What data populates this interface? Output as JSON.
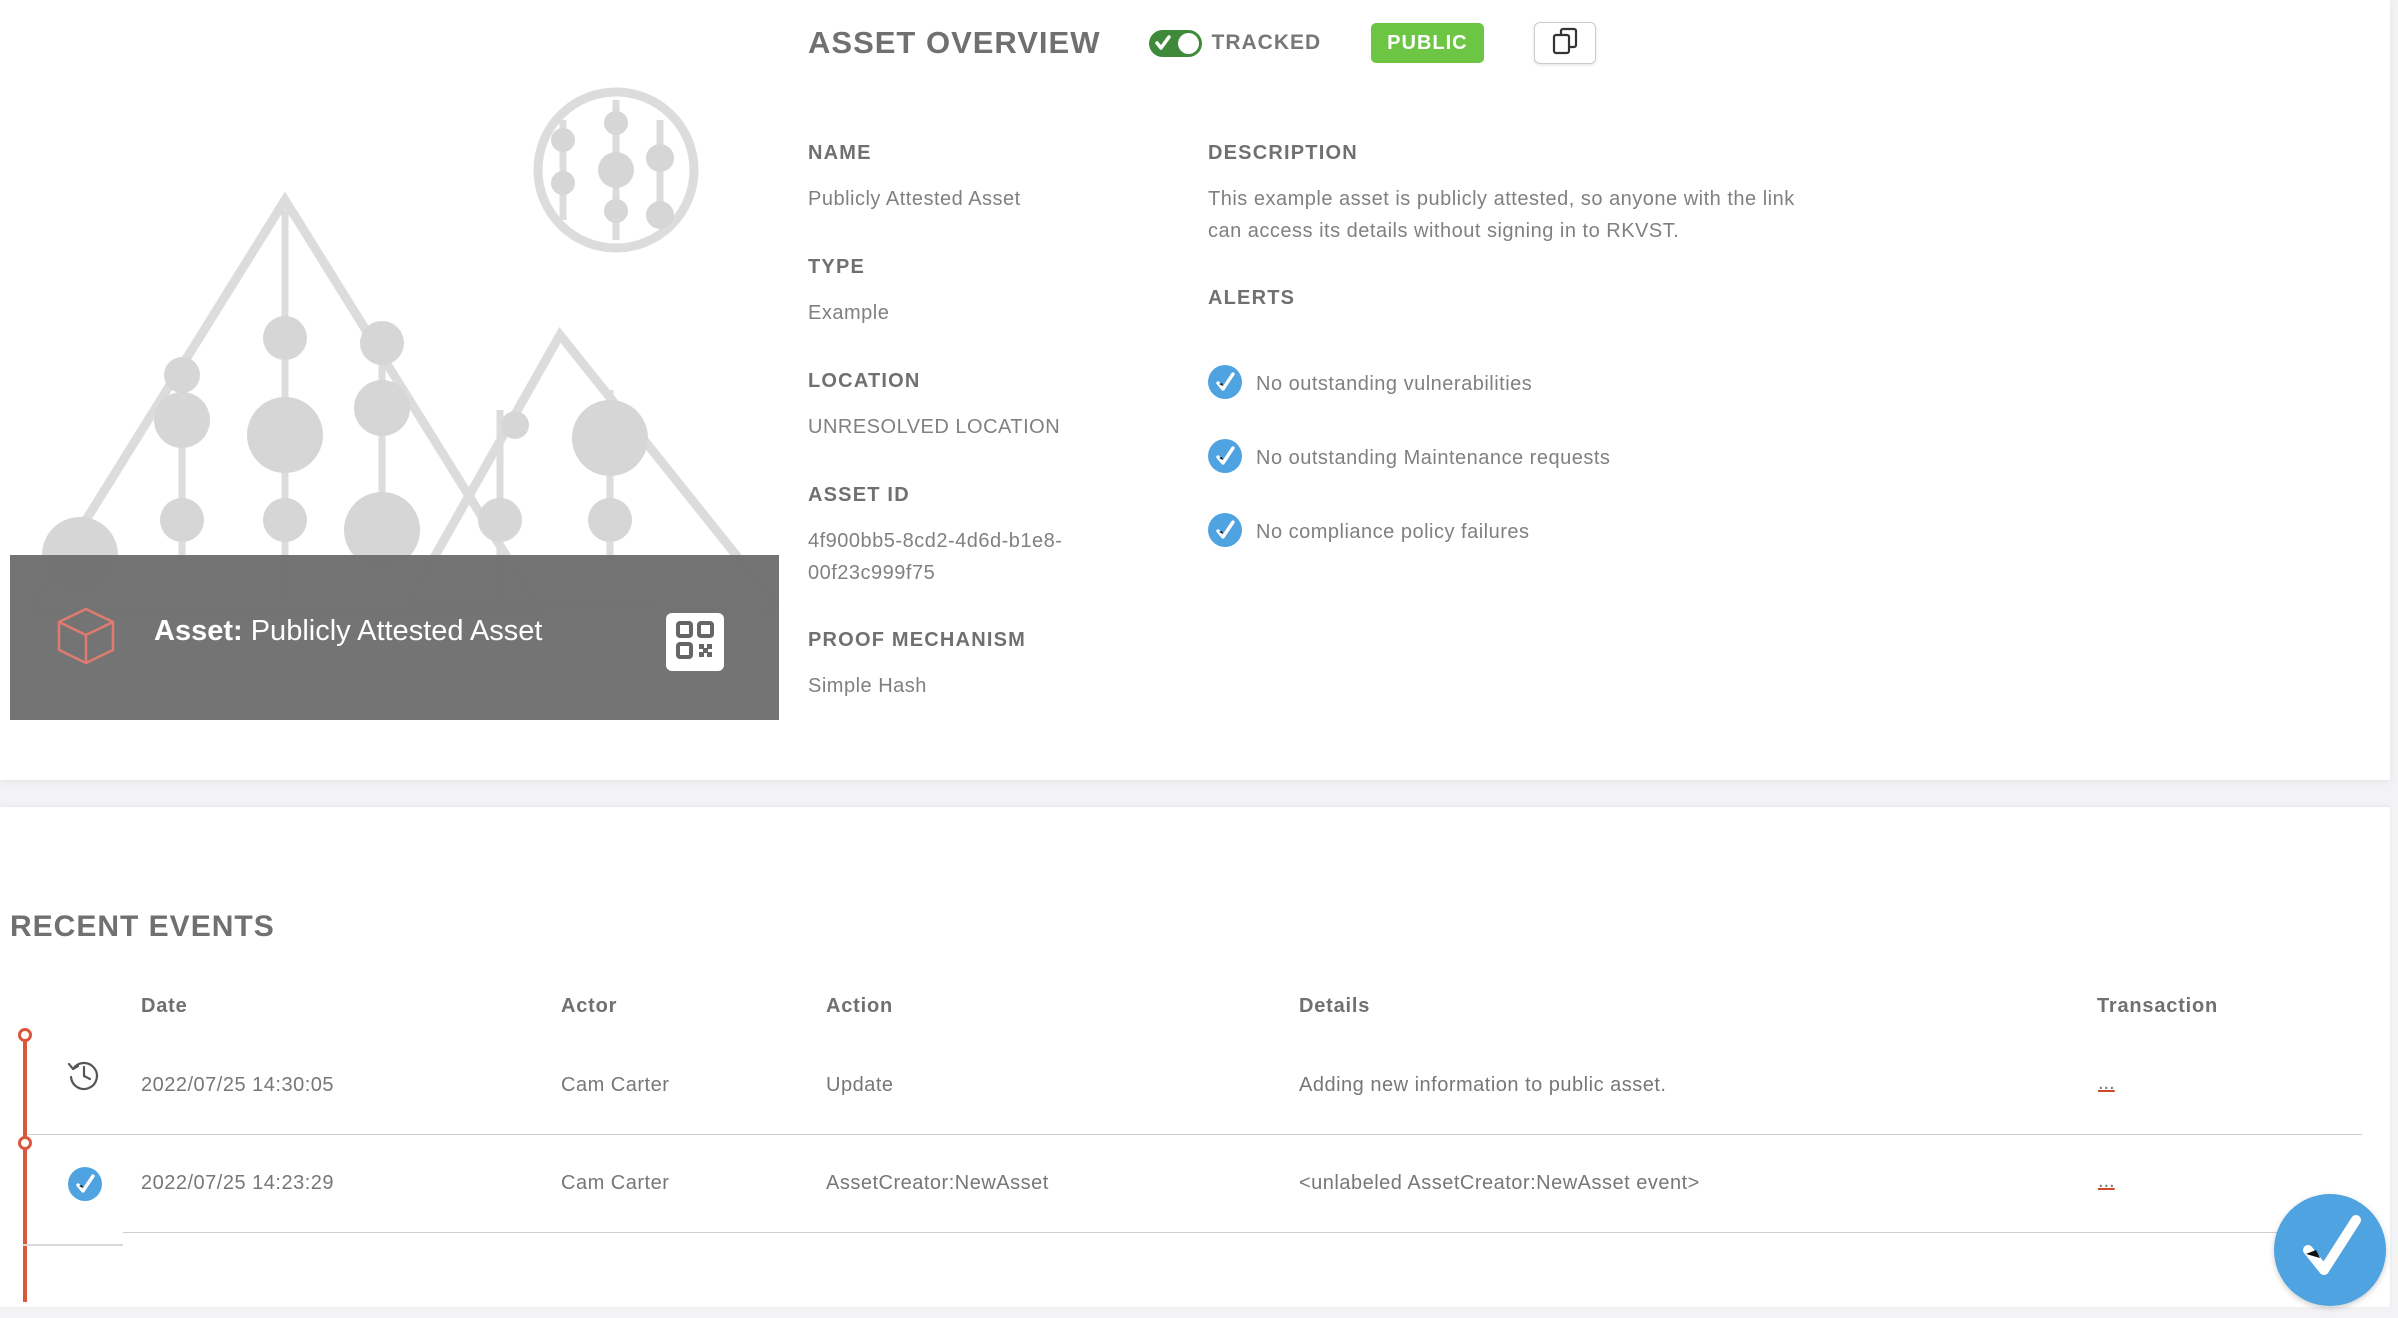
{
  "hero": {
    "asset_prefix": "Asset:",
    "asset_name": "Publicly Attested Asset",
    "cube_icon": "cube-icon",
    "qr_icon": "qr-code-icon"
  },
  "overview": {
    "title": "ASSET OVERVIEW",
    "tracked_label": "TRACKED",
    "tracked_on": true,
    "public_badge": "PUBLIC",
    "copy_icon": "copy-icon",
    "fields": {
      "name": {
        "label": "NAME",
        "value": "Publicly Attested Asset"
      },
      "type": {
        "label": "TYPE",
        "value": "Example"
      },
      "location": {
        "label": "LOCATION",
        "value": "UNRESOLVED LOCATION"
      },
      "asset_id": {
        "label": "ASSET ID",
        "value_line1": "4f900bb5-8cd2-4d6d-b1e8-",
        "value_line2": "00f23c999f75"
      },
      "proof": {
        "label": "PROOF MECHANISM",
        "value": "Simple Hash"
      },
      "description": {
        "label": "DESCRIPTION",
        "value_line1": "This example asset is publicly attested, so anyone with the link",
        "value_line2": "can access its details without signing in to RKVST."
      }
    },
    "alerts": {
      "label": "ALERTS",
      "items": [
        "No outstanding vulnerabilities",
        "No outstanding Maintenance requests",
        "No compliance policy failures"
      ]
    }
  },
  "events": {
    "title": "RECENT EVENTS",
    "columns": {
      "date": "Date",
      "actor": "Actor",
      "action": "Action",
      "details": "Details",
      "transaction": "Transaction"
    },
    "rows": [
      {
        "icon": "history-icon",
        "date": "2022/07/25 14:30:05",
        "actor": "Cam Carter",
        "action": "Update",
        "details": "Adding new information to public asset.",
        "transaction": "..."
      },
      {
        "icon": "check-circle-icon",
        "date": "2022/07/25 14:23:29",
        "actor": "Cam Carter",
        "action": "AssetCreator:NewAsset",
        "details": "<unlabeled AssetCreator:NewAsset event>",
        "transaction": "..."
      }
    ]
  },
  "colors": {
    "accent_orange": "#d9573a",
    "public_green": "#6cc644",
    "toggle_green": "#3f8a3a",
    "check_blue": "#4fa3e0"
  }
}
